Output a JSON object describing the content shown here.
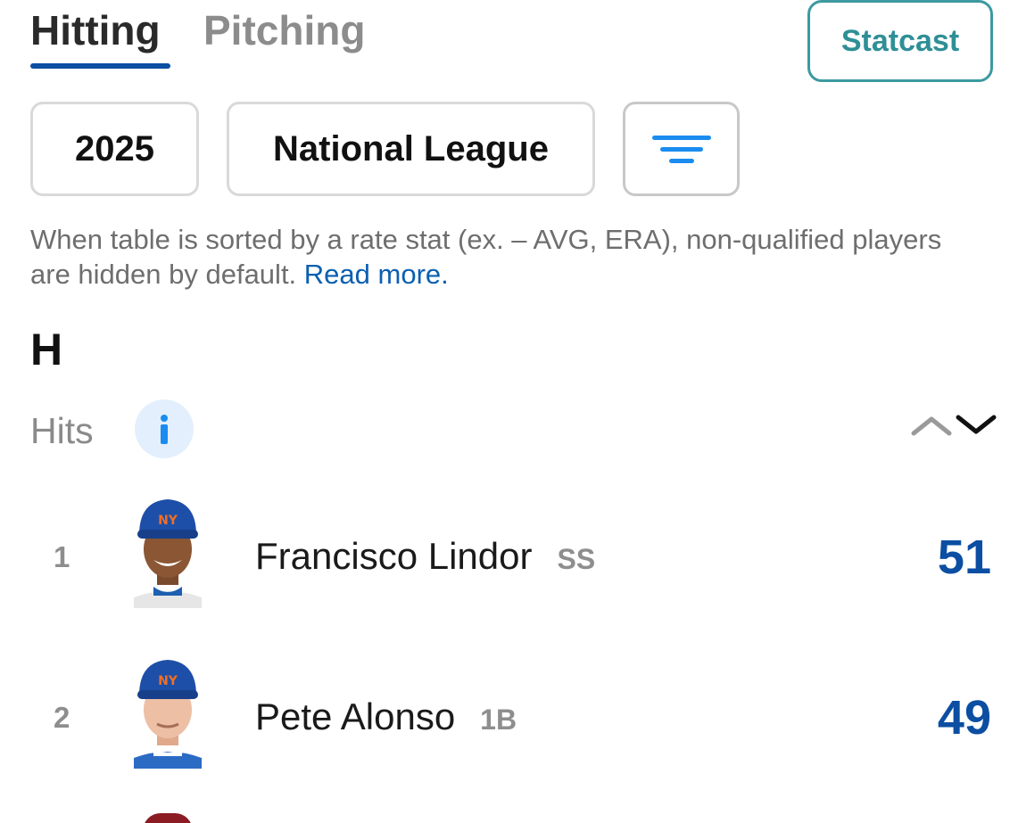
{
  "tabs": [
    {
      "label": "Hitting",
      "active": true
    },
    {
      "label": "Pitching",
      "active": false
    }
  ],
  "statcast_label": "Statcast",
  "filters": {
    "season": "2025",
    "league": "National League"
  },
  "note": {
    "text": "When table is sorted by a rate stat (ex. – AVG, ERA), non-qualified players are hidden by default.",
    "link": "Read more."
  },
  "stat": {
    "abbr": "H",
    "name": "Hits",
    "info": "i"
  },
  "players": [
    {
      "rank": "1",
      "name": "Francisco Lindor",
      "position": "SS",
      "value": "51"
    },
    {
      "rank": "2",
      "name": "Pete Alonso",
      "position": "1B",
      "value": "49"
    }
  ],
  "colors": {
    "accent": "#0b4ea2",
    "statcast": "#3c9aa0",
    "link": "#0b5fb0",
    "filter_icon": "#1a8cf0"
  },
  "icons": {
    "filter": "filter-lines-icon",
    "info": "info-icon",
    "sort": "sort-up-down-icon"
  }
}
